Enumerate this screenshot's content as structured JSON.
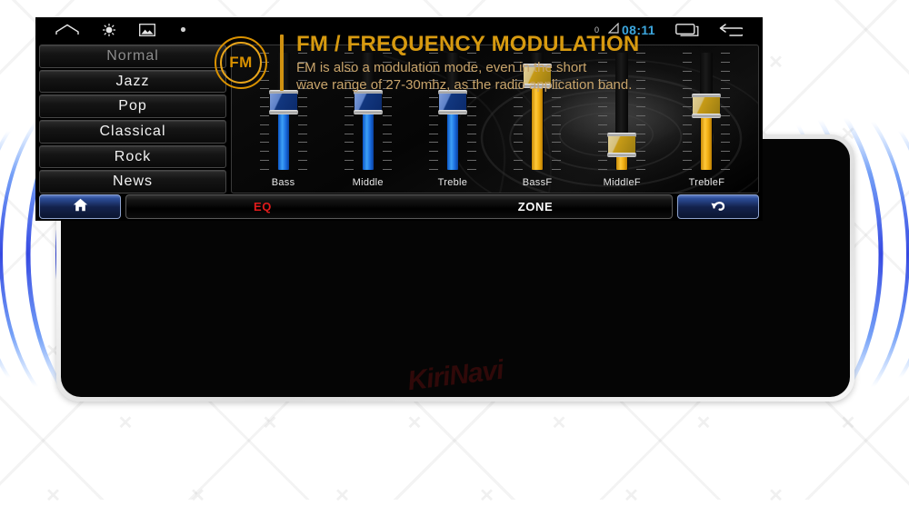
{
  "header": {
    "badge_text": "FM",
    "badge_icon": "fm-circle-icon",
    "title": "FM / FREQUENCY MODULATION",
    "subtitle_line1": "FM is also a modulation mode, even in the short",
    "subtitle_line2": "wave range of 27-30mhz, as the radio application band.",
    "accent_color": "#d79a10",
    "subtitle_color": "#c8a46b"
  },
  "device": {
    "watermark": "KiriNavi",
    "bezel_color": "#e8e8e8",
    "screen_color": "#000000"
  },
  "statusbar": {
    "left_icons": [
      "home-outline-icon",
      "brightness-icon",
      "image-icon",
      "dot-icon"
    ],
    "battery_text": "0",
    "signal_icon": "signal-triangle-icon",
    "clock": "08:11",
    "clock_color": "#3ca6dd",
    "right_icons": [
      "recent-apps-icon",
      "back-arrow-icon"
    ]
  },
  "presets": {
    "items": [
      {
        "label": "Normal",
        "state": "dim"
      },
      {
        "label": "Jazz",
        "state": "normal"
      },
      {
        "label": "Pop",
        "state": "normal"
      },
      {
        "label": "Classical",
        "state": "normal"
      },
      {
        "label": "Rock",
        "state": "normal"
      },
      {
        "label": "News",
        "state": "normal"
      }
    ]
  },
  "equalizer": {
    "sliders": [
      {
        "label": "Bass",
        "color": "blue",
        "value_pct": 56
      },
      {
        "label": "Middle",
        "color": "blue",
        "value_pct": 56
      },
      {
        "label": "Treble",
        "color": "blue",
        "value_pct": 56
      },
      {
        "label": "BassF",
        "color": "amber",
        "value_pct": 76
      },
      {
        "label": "MiddleF",
        "color": "amber",
        "value_pct": 23
      },
      {
        "label": "TrebleF",
        "color": "amber",
        "value_pct": 53
      }
    ],
    "blue_color": "#2e8ef0",
    "amber_color": "#f0ad10"
  },
  "toolbar": {
    "home_icon": "home-icon",
    "back_icon": "back-arrow-icon",
    "eq_label": "EQ",
    "eq_color": "#e01b1b",
    "zone_label": "ZONE",
    "zone_color": "#ffffff"
  }
}
